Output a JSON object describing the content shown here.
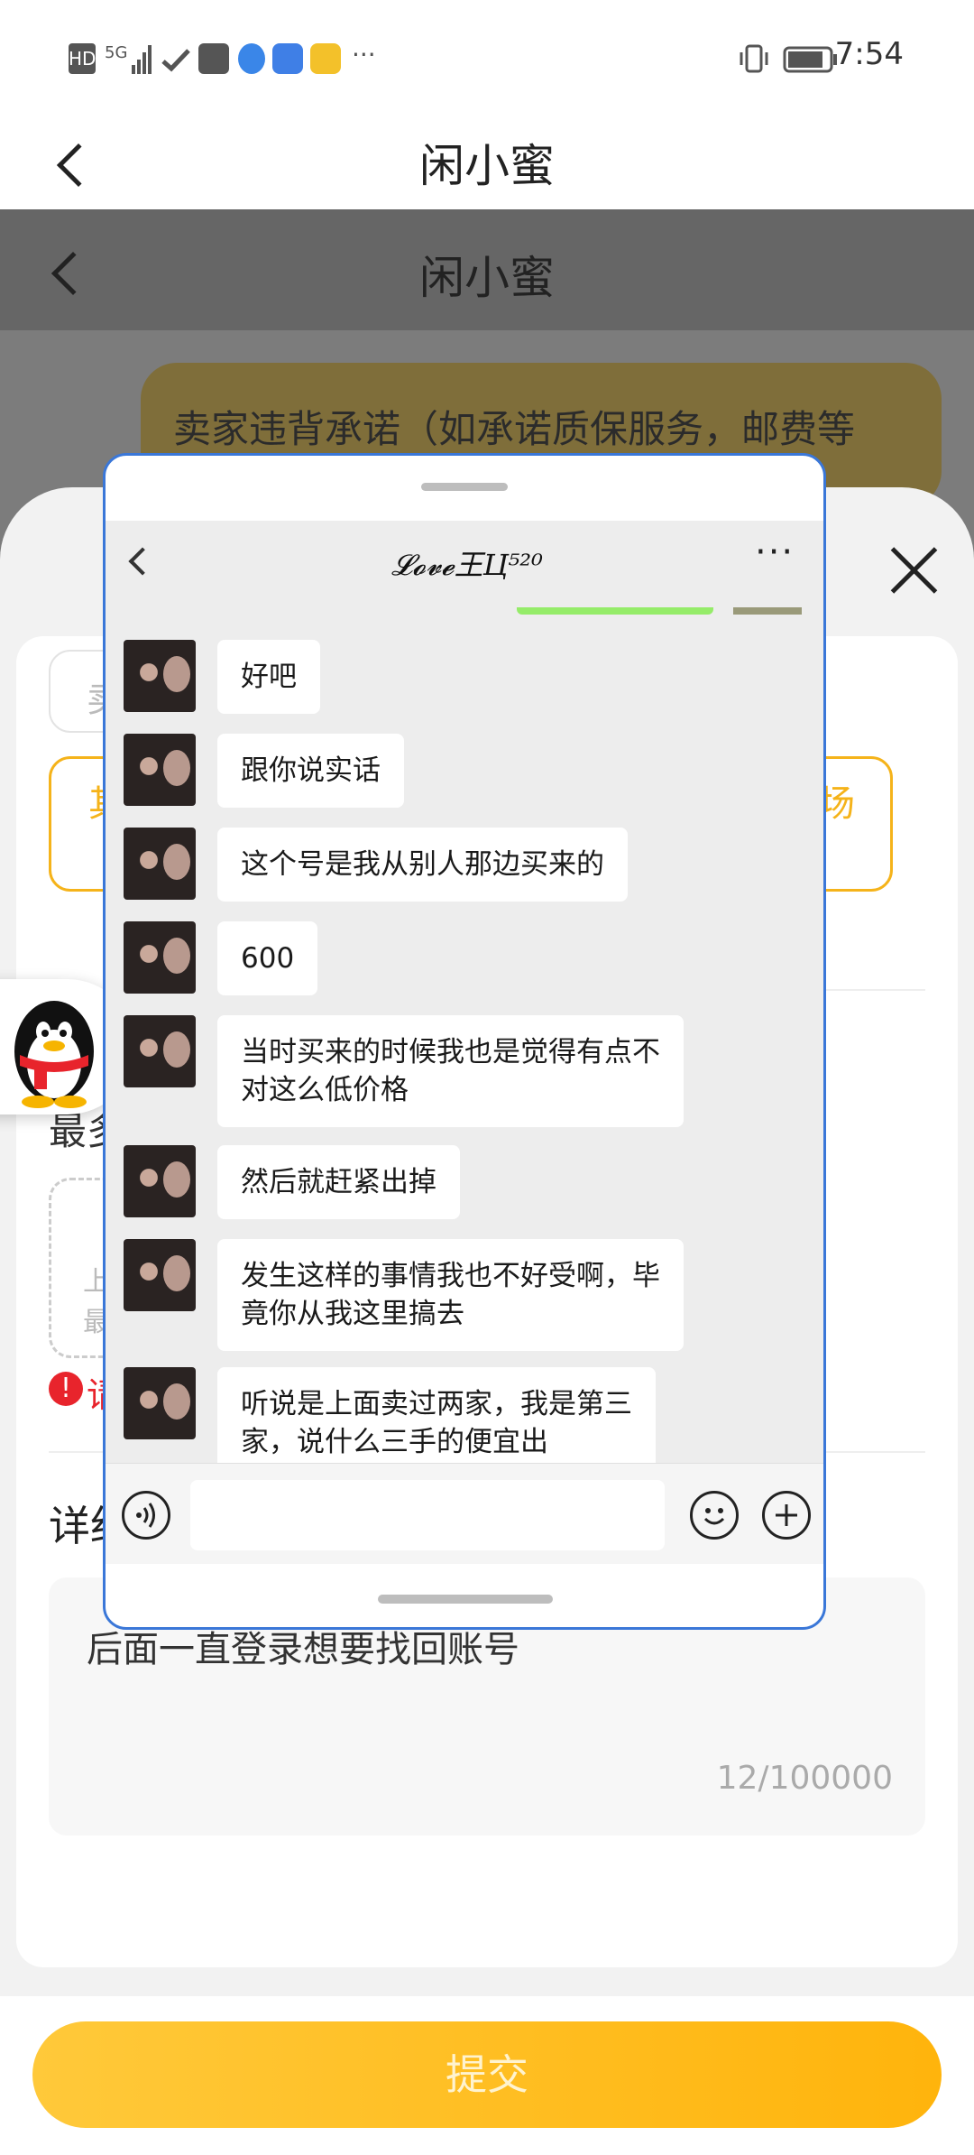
{
  "status_bar": {
    "network_hd": "HD",
    "network_5g": "5G",
    "more": "···",
    "time": "7:54"
  },
  "header": {
    "title": "闲小蜜"
  },
  "background": {
    "header_title": "闲小蜜",
    "notice_text": "卖家违背承诺（如承诺质保服务，邮费等"
  },
  "form": {
    "fragment_seller": "卖",
    "fragment_yellow_left": "其",
    "fragment_yellow_right": "场",
    "most_label": "最多",
    "upload_line1": "上",
    "upload_line2": "最",
    "warning_icon": "!",
    "warning_text": "请",
    "detail_label": "详细",
    "detail_value": "后面一直登录想要找回账号",
    "detail_count": "12/100000",
    "submit_label": "提交"
  },
  "chat": {
    "title": "𝓛𝓸𝓿𝓮王Ц⁵²⁰",
    "more": "···",
    "messages": [
      {
        "text": "好吧"
      },
      {
        "text": "跟你说实话"
      },
      {
        "text": "这个号是我从别人那边买来的"
      },
      {
        "text": "600"
      },
      {
        "text": "当时买来的时候我也是觉得有点不\n对这么低价格"
      },
      {
        "text": "然后就赶紧出掉"
      },
      {
        "text": "发生这样的事情我也不好受啊，毕\n竟你从我这里搞去"
      },
      {
        "text": "听说是上面卖过两家，我是第三\n家，说什么三手的便宜出"
      }
    ]
  },
  "colors": {
    "accent_yellow": "#ffb40c",
    "window_border": "#3a77d8",
    "warning_red": "#e8242c",
    "sent_bubble_green": "#95ec69"
  },
  "icons": [
    "back-icon",
    "close-icon",
    "more-icon",
    "voice-icon",
    "emoji-icon",
    "plus-icon",
    "qq-penguin-icon",
    "warning-icon"
  ]
}
